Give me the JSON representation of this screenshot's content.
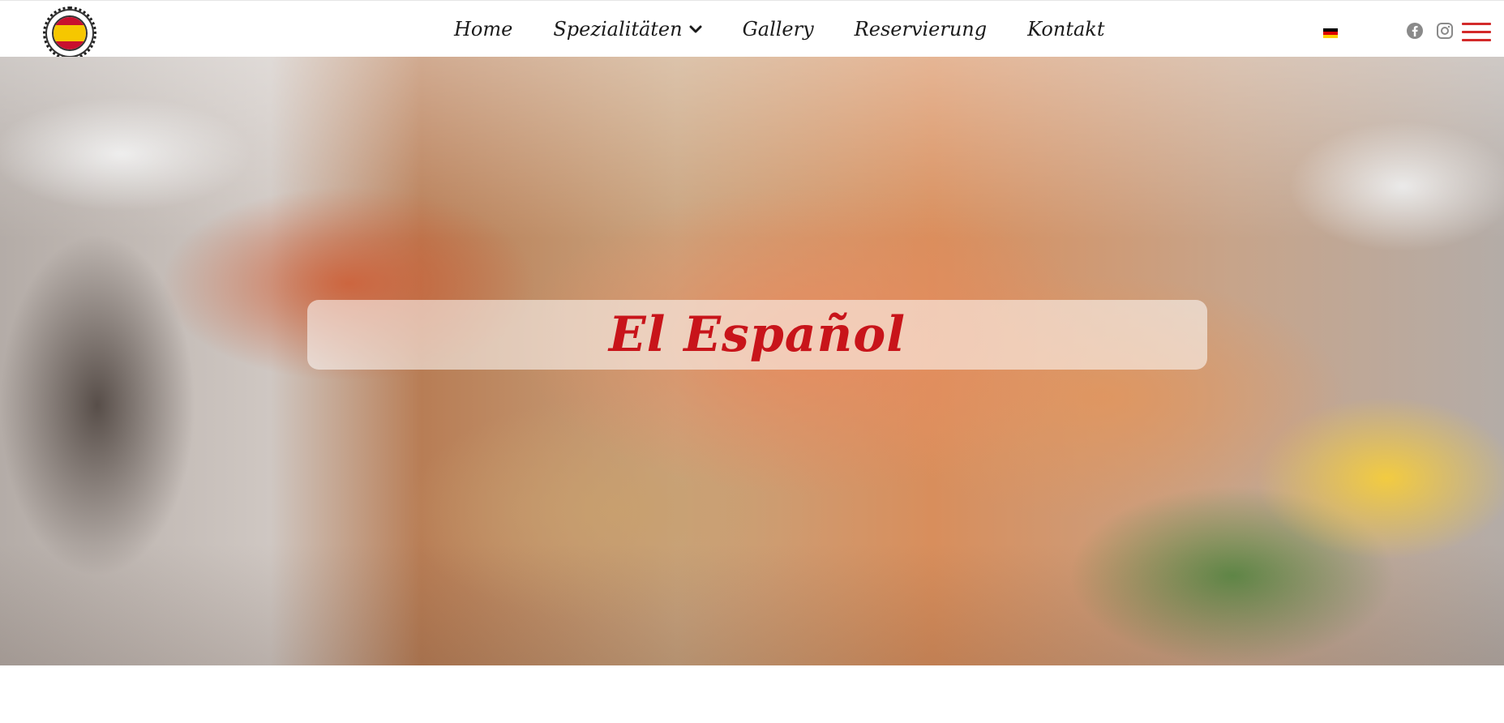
{
  "nav": {
    "items": [
      {
        "label": "Home"
      },
      {
        "label": "Spezialitäten",
        "has_dropdown": true
      },
      {
        "label": "Gallery"
      },
      {
        "label": "Reservierung"
      },
      {
        "label": "Kontakt"
      }
    ]
  },
  "language": {
    "icon": "german-flag-icon"
  },
  "social": {
    "facebook_icon": "facebook-icon",
    "instagram_icon": "instagram-icon"
  },
  "menu": {
    "icon": "hamburger-menu-icon",
    "color": "#d32a2a"
  },
  "hero": {
    "title": "El Español",
    "title_color": "#c8141a"
  }
}
